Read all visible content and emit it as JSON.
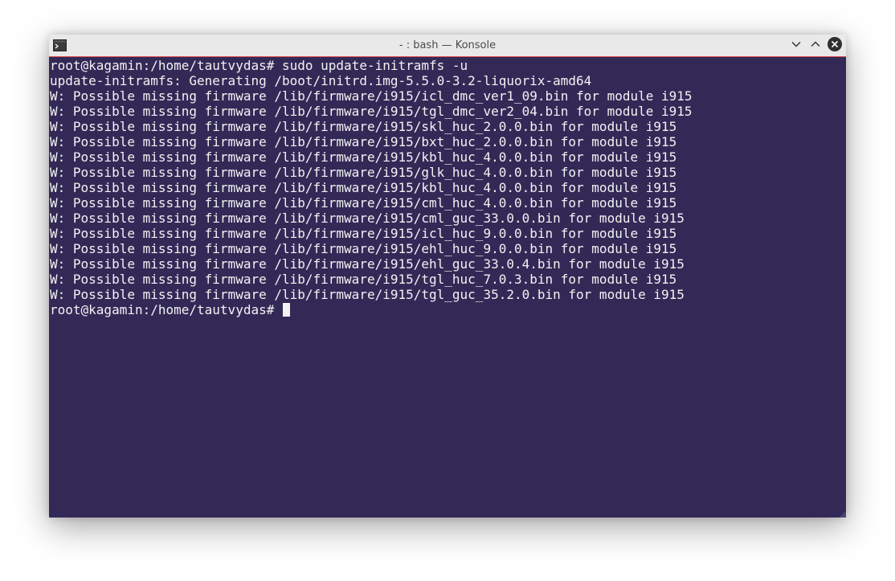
{
  "window": {
    "title": "- : bash — Konsole",
    "icon": "terminal-icon",
    "controls": [
      "minimize-icon",
      "maximize-icon",
      "close-icon"
    ]
  },
  "colors": {
    "terminal_bg": "#332957",
    "terminal_fg": "#f2f2f2",
    "titlebar_bg": "#e9e9ea",
    "titlebar_accent": "#d94a4a"
  },
  "terminal": {
    "lines": [
      "root@kagamin:/home/tautvydas# sudo update-initramfs -u",
      "update-initramfs: Generating /boot/initrd.img-5.5.0-3.2-liquorix-amd64",
      "W: Possible missing firmware /lib/firmware/i915/icl_dmc_ver1_09.bin for module i915",
      "W: Possible missing firmware /lib/firmware/i915/tgl_dmc_ver2_04.bin for module i915",
      "W: Possible missing firmware /lib/firmware/i915/skl_huc_2.0.0.bin for module i915",
      "W: Possible missing firmware /lib/firmware/i915/bxt_huc_2.0.0.bin for module i915",
      "W: Possible missing firmware /lib/firmware/i915/kbl_huc_4.0.0.bin for module i915",
      "W: Possible missing firmware /lib/firmware/i915/glk_huc_4.0.0.bin for module i915",
      "W: Possible missing firmware /lib/firmware/i915/kbl_huc_4.0.0.bin for module i915",
      "W: Possible missing firmware /lib/firmware/i915/cml_huc_4.0.0.bin for module i915",
      "W: Possible missing firmware /lib/firmware/i915/cml_guc_33.0.0.bin for module i915",
      "W: Possible missing firmware /lib/firmware/i915/icl_huc_9.0.0.bin for module i915",
      "W: Possible missing firmware /lib/firmware/i915/ehl_huc_9.0.0.bin for module i915",
      "W: Possible missing firmware /lib/firmware/i915/ehl_guc_33.0.4.bin for module i915",
      "W: Possible missing firmware /lib/firmware/i915/tgl_huc_7.0.3.bin for module i915",
      "W: Possible missing firmware /lib/firmware/i915/tgl_guc_35.2.0.bin for module i915"
    ],
    "prompt": "root@kagamin:/home/tautvydas# "
  }
}
